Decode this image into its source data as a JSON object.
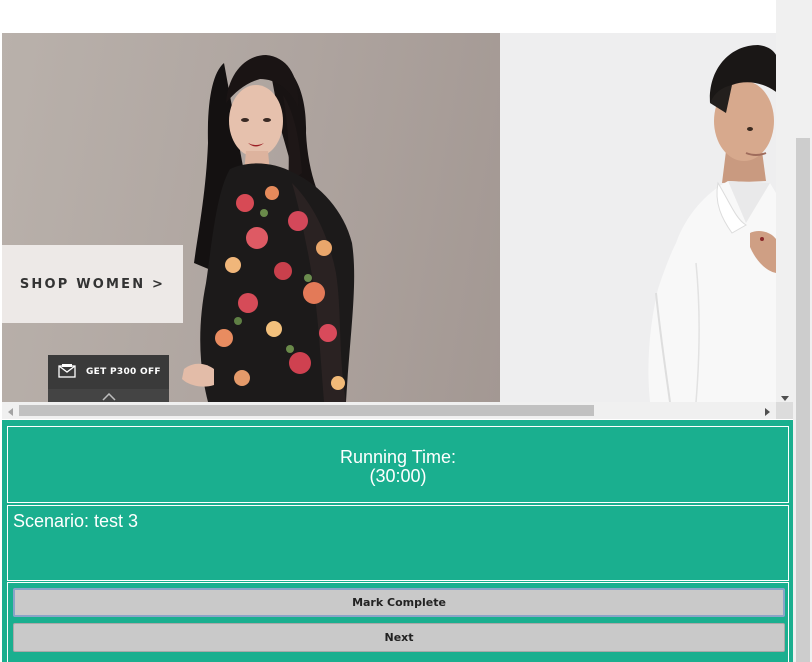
{
  "browser": {
    "scroll": {
      "page_vertical_position": 0.0,
      "outer_vertical_position": 1.0,
      "horizontal_position": 0.0
    }
  },
  "banner": {
    "shop_women_label": "SHOP WOMEN >",
    "promo_label": "GET P300 OFF",
    "icons": {
      "promo": "voucher-icon",
      "promo_toggle": "chevron-up-icon"
    }
  },
  "task_panel": {
    "running_time_label": "Running Time:",
    "running_time_value": "(30:00)",
    "scenario_text": "Scenario: test 3",
    "mark_complete_label": "Mark Complete",
    "next_label": "Next",
    "colors": {
      "accent": "#1aaf8f",
      "button": "#c9c9c9",
      "focus_ring": "#8aa4c8"
    }
  }
}
